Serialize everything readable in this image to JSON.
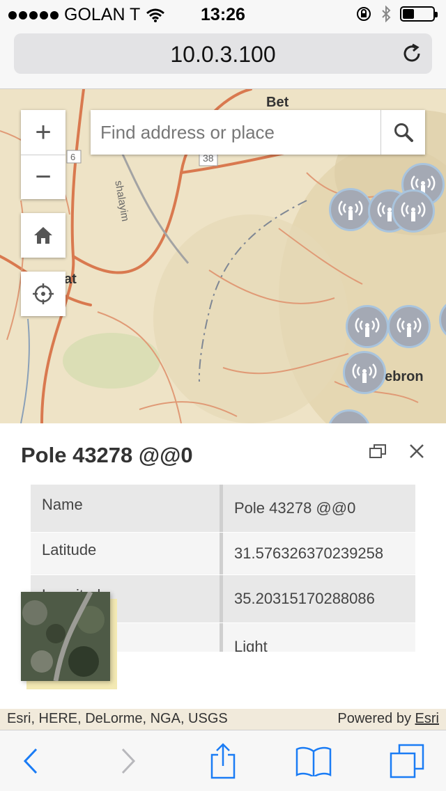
{
  "status_bar": {
    "carrier": "GOLAN T",
    "time": "13:26",
    "battery_level": 0.35
  },
  "browser": {
    "url": "10.0.3.100"
  },
  "map": {
    "search": {
      "placeholder": "Find address or place"
    },
    "zoom_in_label": "+",
    "zoom_out_label": "−",
    "labels": {
      "bet": "Bet",
      "route_6": "6",
      "route_38": "38",
      "shalayim": "shalayim",
      "at": "at",
      "hebron": "ebron"
    }
  },
  "popup": {
    "title": "Pole 43278 @@0",
    "attributes": [
      {
        "key": "Name",
        "value": "Pole 43278 @@0"
      },
      {
        "key": "Latitude",
        "value": "31.576326370239258"
      },
      {
        "key": "Longitude",
        "value": "35.20315170288086"
      },
      {
        "key": "",
        "value": "Light"
      }
    ]
  },
  "attribution": {
    "sources": "Esri, HERE, DeLorme, NGA, USGS",
    "powered_by": "Powered by",
    "powered_by_link": "Esri"
  },
  "colors": {
    "ios_blue": "#1a7cf5",
    "map_base": "#eee3c6",
    "road": "#d9794f",
    "pole_marker": "#a4a9b4",
    "pole_marker_border": "#a9c4dd"
  }
}
